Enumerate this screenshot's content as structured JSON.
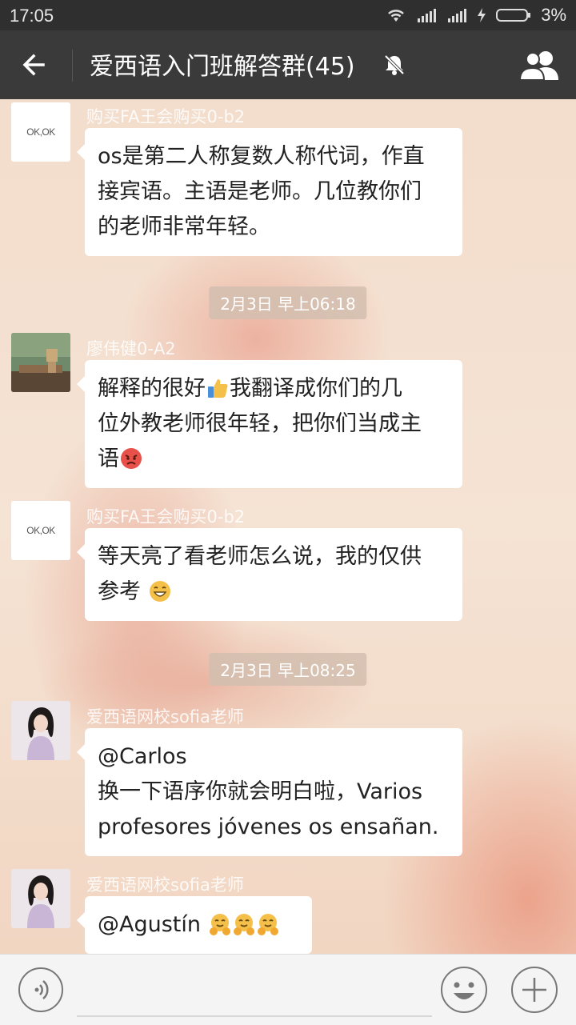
{
  "status_bar": {
    "time": "17:05",
    "battery": "3%"
  },
  "header": {
    "title": "爱西语入门班解答群(45)"
  },
  "messages": [
    {
      "avatar_text": "OK,OK",
      "sender": "购买FA王会购买0-b2",
      "lines": [
        "os是第二人称复数人称代词，作直",
        "接宾语。主语是老师。几位教你们",
        "的老师非常年轻。"
      ]
    },
    {
      "sender": "廖伟健0-A2",
      "lines": [
        "解释的很好",
        "我翻译成你们的几",
        "位外教老师很年轻，把你们当成主",
        "语"
      ]
    },
    {
      "avatar_text": "OK,OK",
      "sender": "购买FA王会购买0-b2",
      "lines": [
        "等天亮了看老师怎么说，我的仅供",
        "参考"
      ]
    },
    {
      "sender": "爱西语网校sofia老师",
      "lines": [
        "@Carlos",
        "换一下语序你就会明白啦，Varios",
        "profesores jóvenes os ensañan."
      ]
    },
    {
      "sender": "爱西语网校sofia老师",
      "lines": [
        "@Agustín"
      ]
    }
  ],
  "timestamps": [
    "2月3日 早上06:18",
    "2月3日 早上08:25"
  ],
  "icons": {
    "back": "arrow-left-icon",
    "mute": "bell-off-icon",
    "members": "people-icon",
    "voice": "voice-icon",
    "emoji": "smiley-icon",
    "plus": "plus-icon"
  },
  "colors": {
    "header_bg": "#3a3a3a",
    "status_bg": "#2f2f2f",
    "bubble_bg": "#ffffff"
  }
}
